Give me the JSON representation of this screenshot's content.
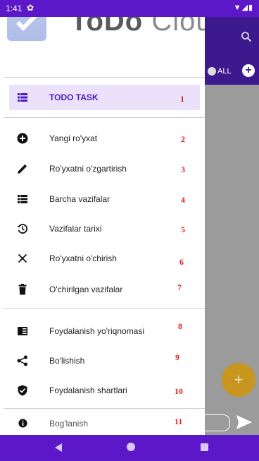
{
  "status_bar": {
    "time": "1:41"
  },
  "header": {
    "title_bold": "ToDo",
    "title_light": "Cloud"
  },
  "background_app": {
    "filter_label": "ALL"
  },
  "drawer": {
    "selected": {
      "label": "TODO TASK",
      "number": "1",
      "icon": "list-icon"
    },
    "group1": [
      {
        "label": "Yangi ro'yxat",
        "number": "2",
        "icon": "add-circle-icon"
      },
      {
        "label": "Ro'yxatni o'zgartirish",
        "number": "3",
        "icon": "edit-pencil-icon"
      },
      {
        "label": "Barcha vazifalar",
        "number": "4",
        "icon": "list-icon"
      },
      {
        "label": "Vazifalar tarixi",
        "number": "5",
        "icon": "history-icon"
      },
      {
        "label": "Ro'yxatni o'chirish",
        "number": "6",
        "icon": "close-icon"
      },
      {
        "label": "O'chirilgan vazifalar",
        "number": "7",
        "icon": "trash-icon"
      }
    ],
    "group2": [
      {
        "label": "Foydalanish yo'riqnomasi",
        "number": "8",
        "icon": "guide-icon"
      },
      {
        "label": "Bo'lishish",
        "number": "9",
        "icon": "share-icon"
      },
      {
        "label": "Foydalanish shartlari",
        "number": "10",
        "icon": "shield-check-icon"
      },
      {
        "label": "Bog'lanish",
        "number": "11",
        "icon": "info-icon"
      }
    ]
  },
  "colors": {
    "status_bar": "#5c17c9",
    "toolbar": "#3c1a8d",
    "selected_bg": "#ece1fb",
    "selected_text": "#4a1cbf",
    "fab": "#c8951e",
    "annotation_numbers": "#e01f1f"
  }
}
